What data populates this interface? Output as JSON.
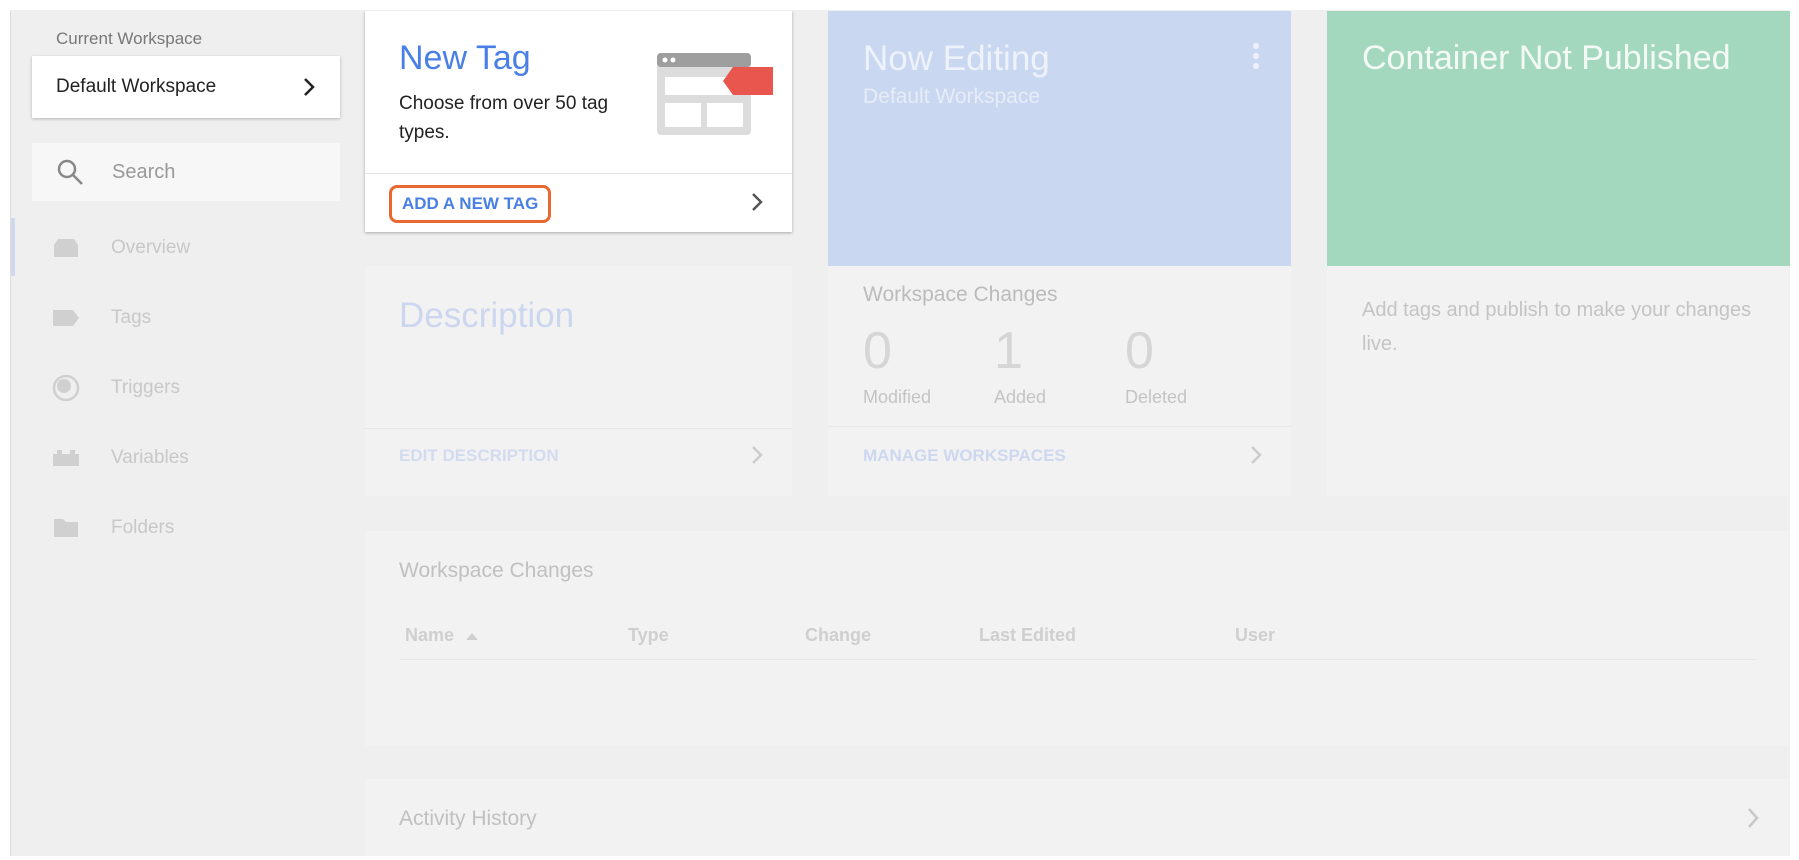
{
  "sidebar": {
    "workspace_label": "Current Workspace",
    "workspace_name": "Default Workspace",
    "search_placeholder": "Search",
    "items": [
      {
        "label": "Overview",
        "icon": "overview-icon"
      },
      {
        "label": "Tags",
        "icon": "tag-icon"
      },
      {
        "label": "Triggers",
        "icon": "trigger-icon"
      },
      {
        "label": "Variables",
        "icon": "variables-icon"
      },
      {
        "label": "Folders",
        "icon": "folder-icon"
      }
    ]
  },
  "new_tag": {
    "title": "New Tag",
    "description": "Choose from over 50 tag types.",
    "action": "ADD A NEW TAG"
  },
  "description_card": {
    "title": "Description",
    "action": "EDIT DESCRIPTION"
  },
  "editing_card": {
    "title": "Now Editing",
    "subtitle": "Default Workspace",
    "changes_title": "Workspace Changes",
    "stats": [
      {
        "value": "0",
        "label": "Modified"
      },
      {
        "value": "1",
        "label": "Added"
      },
      {
        "value": "0",
        "label": "Deleted"
      }
    ],
    "action": "MANAGE WORKSPACES"
  },
  "published_card": {
    "title": "Container Not Published",
    "message": "Add tags and publish to make your changes live."
  },
  "changes_table": {
    "title": "Workspace Changes",
    "columns": [
      "Name",
      "Type",
      "Change",
      "Last Edited",
      "User"
    ]
  },
  "activity": {
    "title": "Activity History"
  },
  "colors": {
    "accent_blue": "#4a7fe6",
    "highlight_orange": "#e8692f",
    "tag_red": "#e8564d",
    "editing_blue": "#c9d7f0",
    "published_green": "#a4d8be"
  }
}
